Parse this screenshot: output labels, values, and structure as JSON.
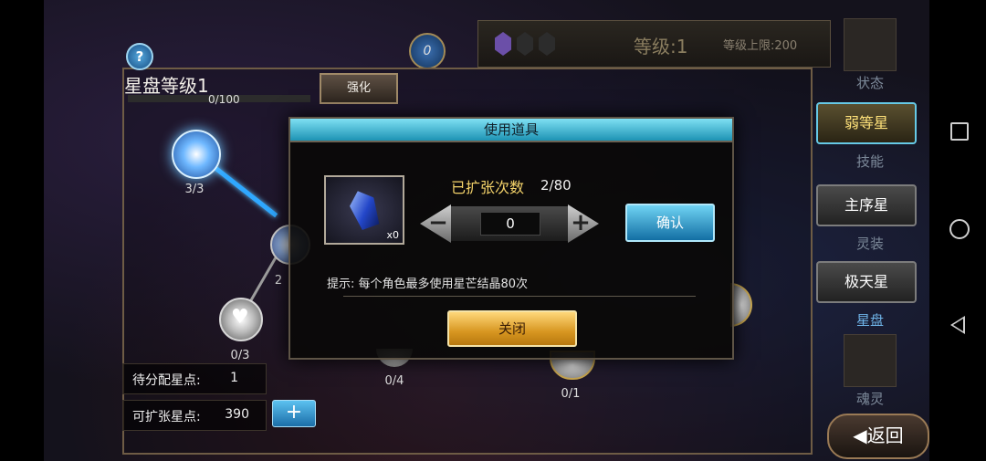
{
  "top": {
    "level_text": "等级:1",
    "level_limit": "等级上限:200",
    "coin_value": "0"
  },
  "side_menu": {
    "status_label": "状态",
    "weak_star_tab": "弱等星",
    "skill_label": "技能",
    "main_star_tab": "主序星",
    "spirit_label": "灵装",
    "ultra_star_tab": "极天星",
    "star_disk_label": "星盘",
    "soul_label": "魂灵",
    "return_label": "返回"
  },
  "panel": {
    "title": "星盘等级1",
    "progress_text": "0/100",
    "progress": 0,
    "help_label": "?",
    "enhance_label": "强化",
    "nodes": [
      {
        "label": "3/3"
      },
      {
        "label": "2"
      },
      {
        "label": "0/3"
      },
      {
        "label": "0/4"
      },
      {
        "label": "0/1"
      }
    ],
    "pending_points_label": "待分配星点:",
    "pending_points_value": "1",
    "expandable_points_label": "可扩张星点:",
    "expandable_points_value": "390",
    "plus_label": "+"
  },
  "dialog": {
    "title": "使用道具",
    "item_qty": "x0",
    "expand_label": "已扩张次数",
    "expand_count": "2/80",
    "minus_symbol": "−",
    "plus_symbol": "+",
    "quantity": "0",
    "confirm_label": "确认",
    "hint": "提示: 每个角色最多使用星芒结晶80次",
    "close_label": "关闭"
  },
  "colors": {
    "accent_blue": "#2fa8ff",
    "title_yellow": "#f4d36a",
    "close_gold": "#d79620"
  }
}
